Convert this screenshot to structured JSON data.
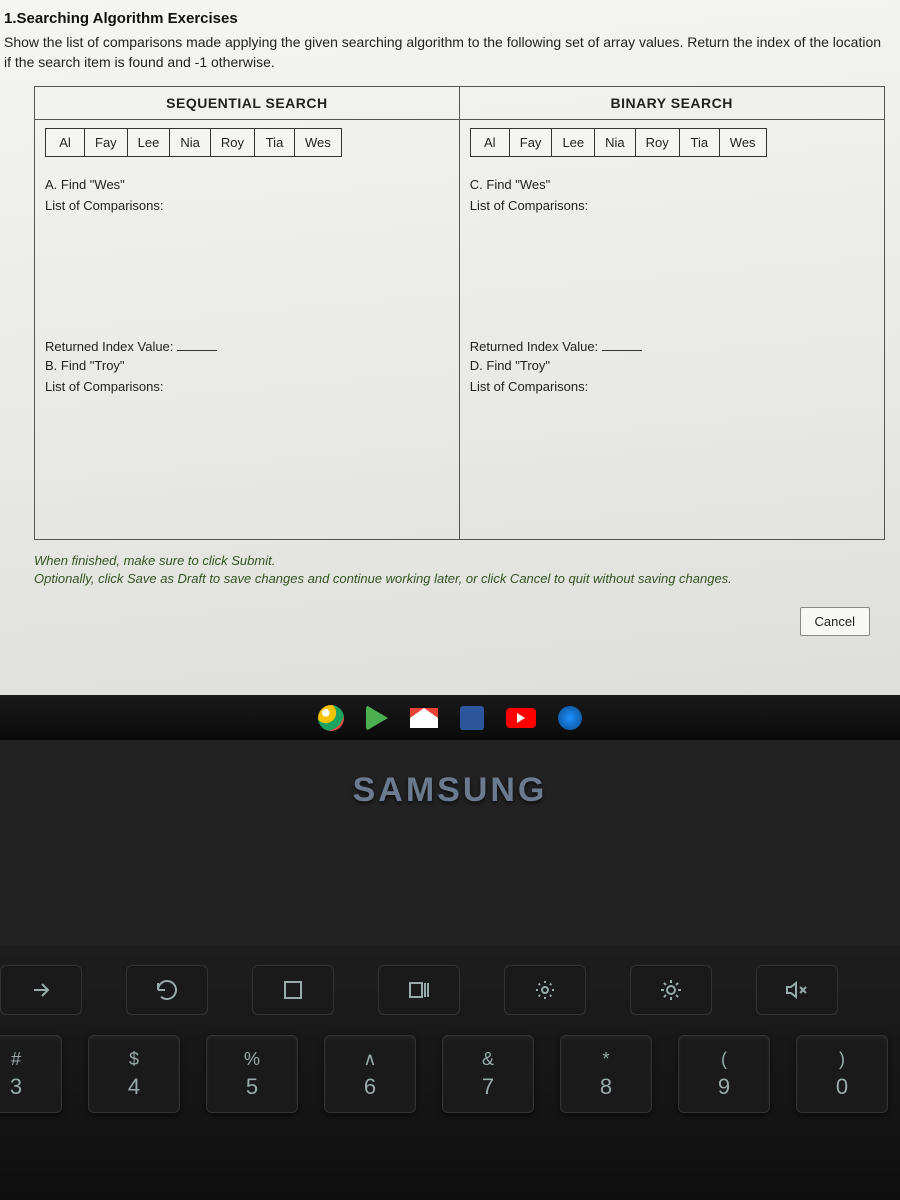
{
  "exercise": {
    "title": "1.Searching Algorithm Exercises",
    "description": "Show the list of comparisons made applying the given searching algorithm to the following set of array values. Return the index of the location if the search item is found and -1 otherwise."
  },
  "table": {
    "headers": [
      "SEQUENTIAL SEARCH",
      "BINARY SEARCH"
    ],
    "array_values": [
      "Al",
      "Fay",
      "Lee",
      "Nia",
      "Roy",
      "Tia",
      "Wes"
    ],
    "left": {
      "task_a": "A. Find \"Wes\"",
      "comparisons_label": "List of Comparisons:",
      "returned_label": "Returned Index Value:",
      "task_b": "B. Find \"Troy\"",
      "comparisons_label_b": "List of Comparisons:"
    },
    "right": {
      "task_c": "C. Find \"Wes\"",
      "comparisons_label": "List of Comparisons:",
      "returned_label": "Returned Index Value:",
      "task_d": "D. Find \"Troy\"",
      "comparisons_label_d": "List of Comparisons:"
    }
  },
  "footer": {
    "line1": "When finished, make sure to click Submit.",
    "line2": "Optionally, click Save as Draft to save changes and continue working later, or click Cancel to quit without saving changes."
  },
  "buttons": {
    "cancel": "Cancel"
  },
  "brand": "SAMSUNG",
  "keyboard": {
    "number_row": [
      {
        "top": "#",
        "bottom": "3"
      },
      {
        "top": "$",
        "bottom": "4"
      },
      {
        "top": "%",
        "bottom": "5"
      },
      {
        "top": "∧",
        "bottom": "6"
      },
      {
        "top": "&",
        "bottom": "7"
      },
      {
        "top": "*",
        "bottom": "8"
      },
      {
        "top": "(",
        "bottom": "9"
      },
      {
        "top": ")",
        "bottom": "0"
      }
    ]
  }
}
